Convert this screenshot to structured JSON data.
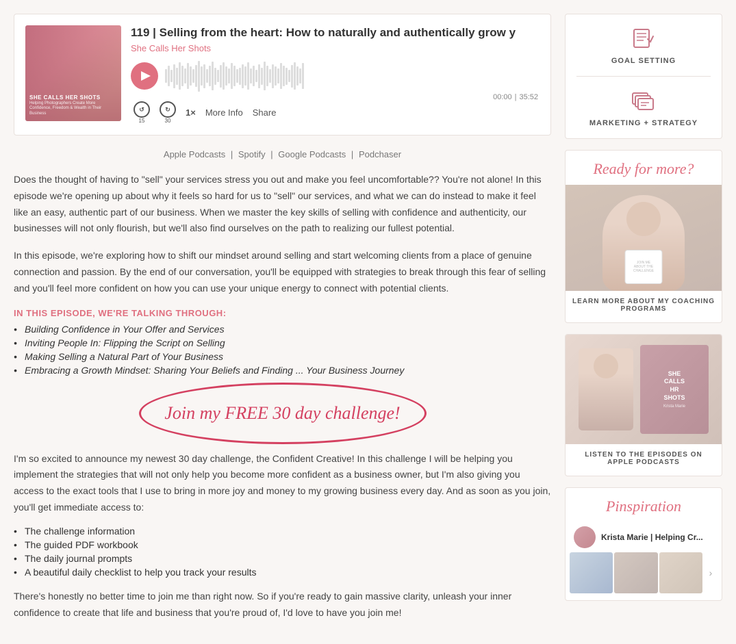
{
  "player": {
    "episode_title": "119 | Selling from the heart: How to naturally and authentically grow y",
    "podcast_name": "She Calls Her Shots",
    "time_current": "00:00",
    "time_separator": "|",
    "time_total": "35:52",
    "speed_label": "1×",
    "more_info_label": "More Info",
    "share_label": "Share",
    "skip_back_label": "15",
    "skip_forward_label": "30",
    "cover_title": "SHE CALLS HER ShOTS",
    "cover_subtitle": "Helping Photographers Create More Confidence, Freedom & Wealth in Their Business"
  },
  "podcast_links": {
    "apple": "Apple Podcasts",
    "sep1": "|",
    "spotify": "Spotify",
    "sep2": "|",
    "google": "Google Podcasts",
    "sep3": "|",
    "podchaser": "Podchaser"
  },
  "description": {
    "para1": "Does the thought of having to \"sell\" your services stress you out and make you feel uncomfortable?? You're not alone! In this episode we're opening up about why it feels so hard for us to \"sell\" our services, and what we can do instead to make it feel like an easy, authentic part of our business. When we master the key skills of selling with confidence and authenticity, our businesses will not only flourish, but we'll also find ourselves on the path to realizing our fullest potential.",
    "para2": "In this episode, we're exploring how to shift our mindset around selling and start welcoming clients from a place of genuine connection and passion. By the end of our conversation, you'll be equipped with strategies to break through this fear of selling and you'll feel more confident on how you can use your unique energy to connect with potential clients.",
    "section_header": "IN THIS EPISODE, WE'RE TALKING THROUGH:",
    "bullets": [
      "Building Confidence in Your Offer and Services",
      "Inviting People In: Flipping the Script on Selling",
      "Making Selling a Natural Part of Your Business",
      "Embracing a Growth Mindset: Sharing Your Beliefs and Finding ... Your Business Journey"
    ]
  },
  "cta": {
    "text": "Join my FREE 30 day challenge!"
  },
  "body_text": {
    "para1": "I'm so excited to announce my newest 30 day challenge, the Confident Creative! In this challenge I will be helping you implement the strategies that will not only help you become more confident as a business owner, but I'm also giving you access to the exact tools that I use to bring in more joy and money to my growing business every day. And as soon as you join, you'll get immediate access to:",
    "benefits": [
      "The challenge information",
      "The guided PDF workbook",
      "The daily journal prompts",
      "A beautiful daily checklist to help you track your results"
    ],
    "para2": "There's honestly no better time to join me than right now. So if you're ready to gain massive clarity, unleash your inner confidence to create that life and business that you're proud of, I'd love to have you join me!"
  },
  "sidebar": {
    "goal_setting_label": "GOAL SETTING",
    "marketing_label": "MARKETING + STRATEGY",
    "ready_title": "Ready for more?",
    "coaching_label": "LEARN MORE ABOUT MY COACHING PROGRAMS",
    "apple_label": "LISTEN TO THE EPISODES ON APPLE PODCASTS",
    "pinspiration_title": "Pinspiration",
    "pin_user": "Krista Marie | Helping Cr..."
  },
  "colors": {
    "accent": "#e07080",
    "dark_accent": "#d44060",
    "text": "#444444",
    "light_text": "#888888"
  }
}
